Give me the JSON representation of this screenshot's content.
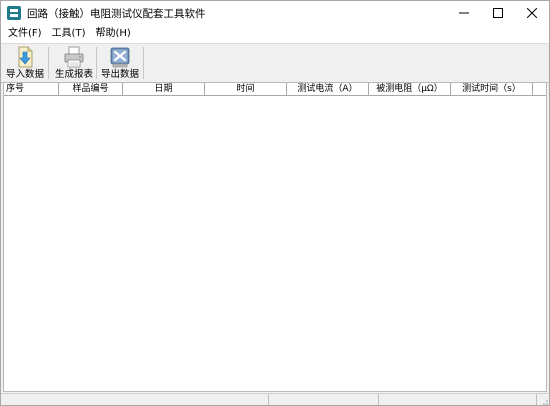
{
  "window": {
    "title": "回路（接触）电阻测试仪配套工具软件",
    "icons": {
      "app": "app-icon",
      "minimize": "minimize-icon",
      "maximize": "maximize-icon",
      "close": "close-icon"
    }
  },
  "menu": {
    "items": [
      {
        "label": "文件(F)"
      },
      {
        "label": "工具(T)"
      },
      {
        "label": "帮助(H)"
      }
    ]
  },
  "toolbar": {
    "buttons": [
      {
        "label": "导入数据",
        "icon": "import-icon"
      },
      {
        "label": "生成报表",
        "icon": "printer-icon"
      },
      {
        "label": "导出数据",
        "icon": "export-icon"
      }
    ]
  },
  "table": {
    "columns": [
      {
        "label": "序号"
      },
      {
        "label": "样品编号"
      },
      {
        "label": "日期"
      },
      {
        "label": "时间"
      },
      {
        "label": "测试电流（A）"
      },
      {
        "label": "被测电阻（μΩ）"
      },
      {
        "label": "测试时间（s）"
      }
    ],
    "rows": []
  },
  "statusbar": {
    "panels": [
      {
        "text": ""
      },
      {
        "text": ""
      },
      {
        "text": ""
      }
    ]
  }
}
